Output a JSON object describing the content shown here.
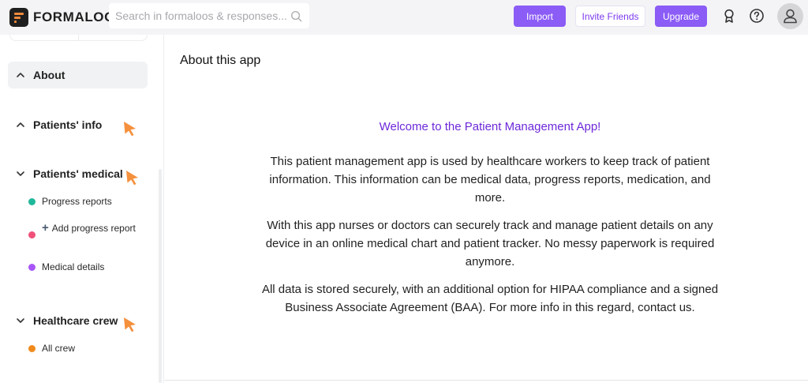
{
  "header": {
    "brand": "FORMALOO",
    "search_placeholder": "Search in formaloos & responses...",
    "import_label": "Import",
    "invite_label": "Invite Friends",
    "upgrade_label": "Upgrade",
    "accent_color": "#8b5cf6"
  },
  "sidebar": {
    "groups": [
      {
        "label": "About",
        "chevron": "chevron-up-icon"
      },
      {
        "label": "Patients' info",
        "chevron": "chevron-up-icon"
      },
      {
        "label": "Patients' medical",
        "chevron": "chevron-down-icon"
      },
      {
        "label": "Healthcare crew",
        "chevron": "chevron-down-icon"
      }
    ],
    "items": [
      {
        "label": "Progress reports",
        "dot_color": "#1fb89a"
      },
      {
        "label": "Add progress report",
        "dot_color": "#f0507a"
      },
      {
        "label": "Medical details",
        "dot_color": "#a855f7"
      },
      {
        "label": "All crew",
        "dot_color": "#f08a1c"
      }
    ],
    "cursor_color": "#f5903d"
  },
  "main": {
    "title": "About this app",
    "welcome": "Welcome to the Patient Management App!",
    "paragraphs": [
      "This patient management app is used by healthcare workers to keep track of patient information. This information can be medical data, progress reports, medication, and more.",
      "With this app nurses or doctors can securely track and manage patient details on any device in an online medical chart and patient tracker. No messy paperwork is required anymore.",
      "All data is stored securely, with an additional option for HIPAA compliance and a signed Business Associate Agreement (BAA). For more info in this regard, contact us."
    ]
  }
}
